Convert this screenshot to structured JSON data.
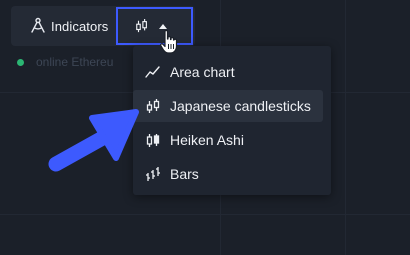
{
  "toolbar": {
    "indicators_label": "Indicators",
    "indicators_icon": "indicators-icon",
    "chart_type_icon": "candlestick-icon",
    "caret_icon": "caret-up-icon",
    "highlight_color": "#3d5afe"
  },
  "status": {
    "text": "online Ethereu",
    "dot_color": "#2bb673"
  },
  "chart_type_menu": {
    "items": [
      {
        "label": "Area chart",
        "icon": "area-chart-icon",
        "active": false
      },
      {
        "label": "Japanese candlesticks",
        "icon": "candlestick-icon",
        "active": true
      },
      {
        "label": "Heiken Ashi",
        "icon": "heiken-ashi-icon",
        "active": false
      },
      {
        "label": "Bars",
        "icon": "bars-icon",
        "active": false
      }
    ]
  },
  "annotation": {
    "arrow_color": "#3d5afe",
    "points_to": "Japanese candlesticks"
  }
}
